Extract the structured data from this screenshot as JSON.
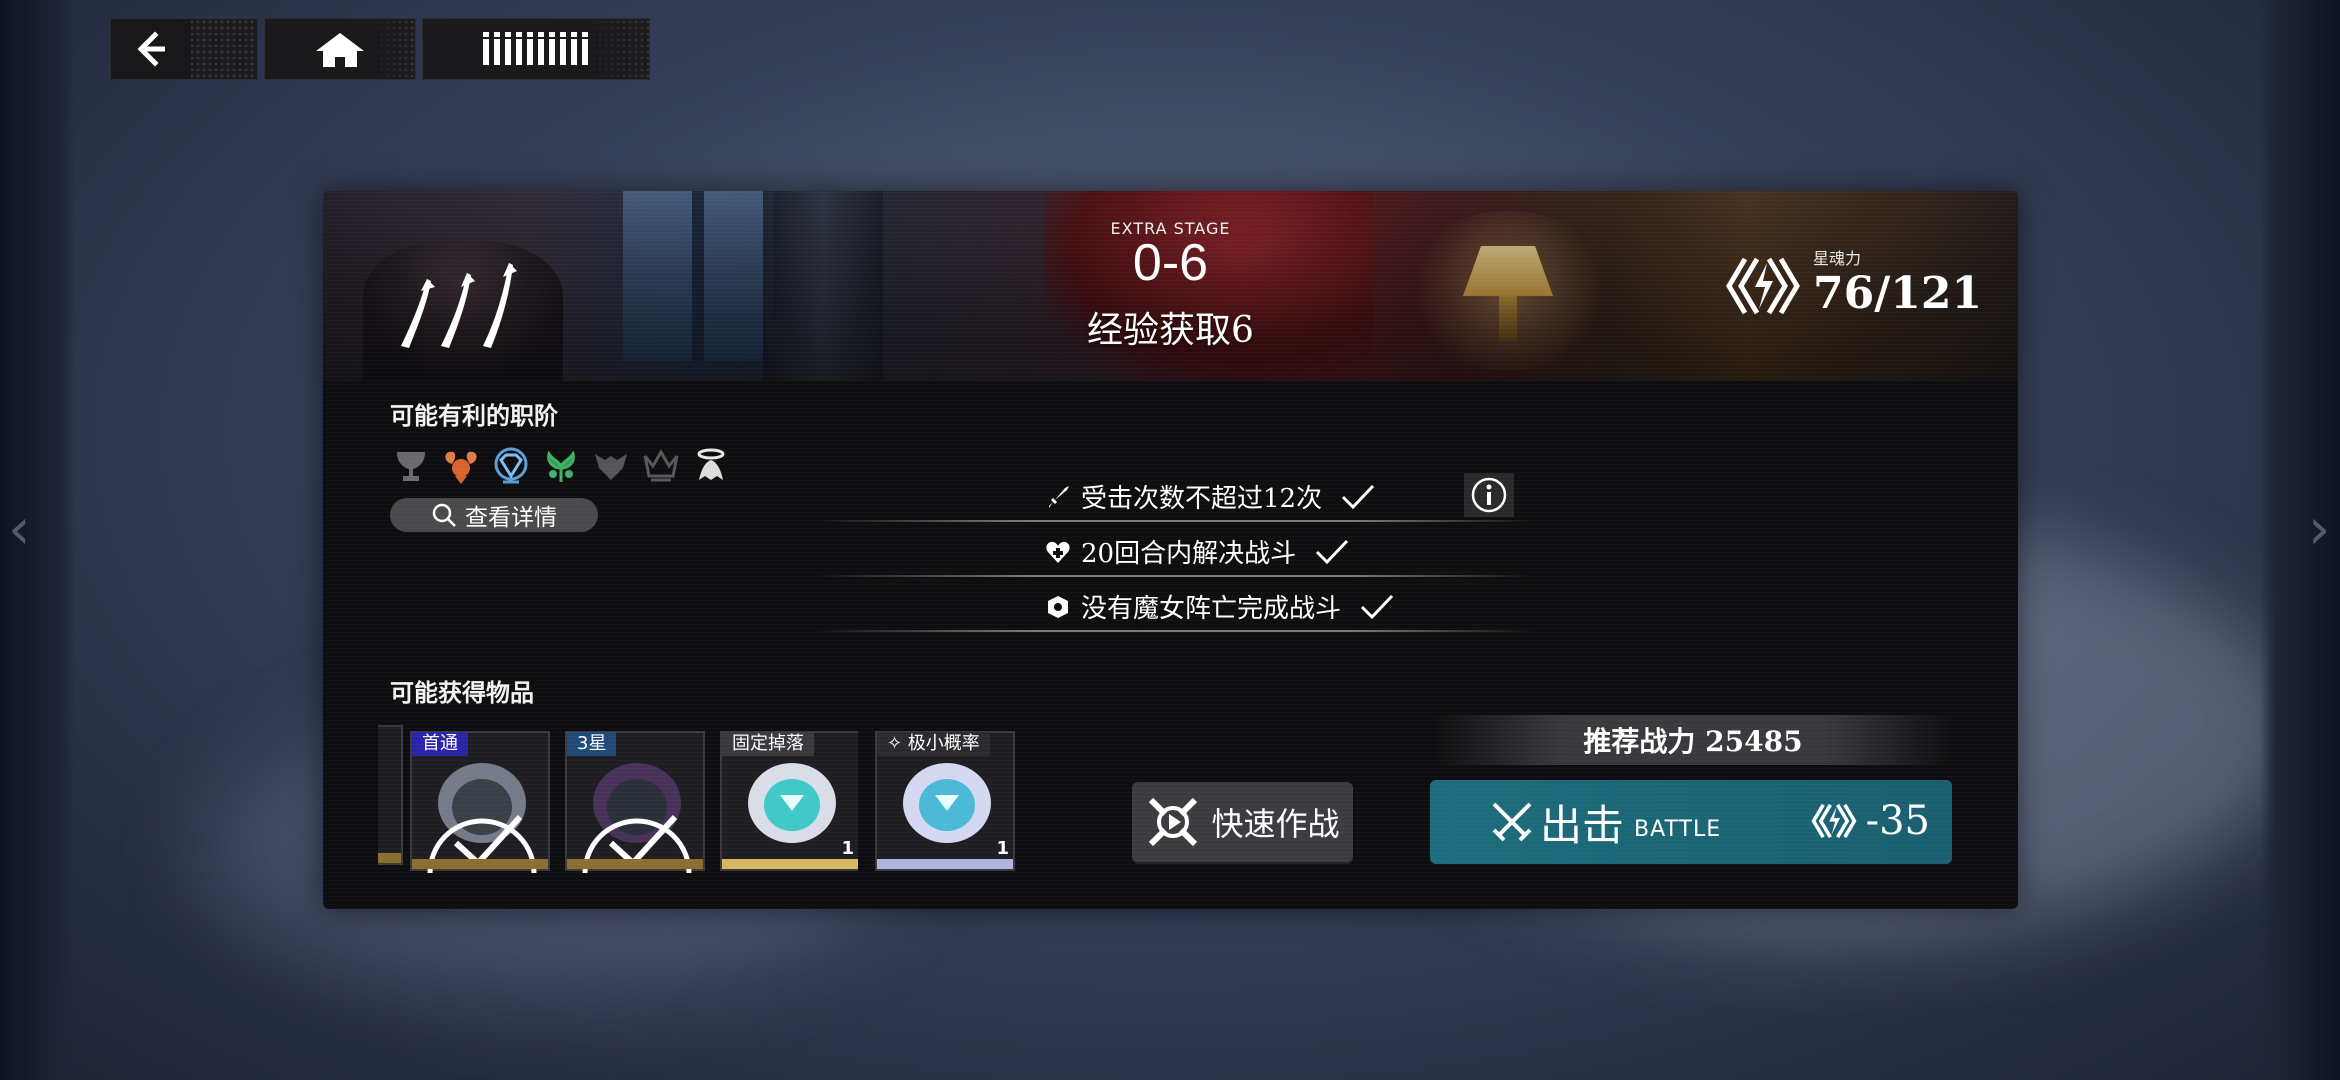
{
  "nav": {
    "back_icon": "back-arrow-icon",
    "home_icon": "home-icon",
    "menu_icon": "menu-bars-icon"
  },
  "stage": {
    "tag": "EXTRA STAGE",
    "number": "0-6",
    "name": "经验获取6",
    "stars_earned": 3
  },
  "stamina": {
    "label": "星魂力",
    "value": "76/121"
  },
  "advantage": {
    "title": "可能有利的职阶",
    "class_icons": [
      "chalice-class-icon",
      "ram-class-icon",
      "gem-class-icon",
      "tree-class-icon",
      "wolf-class-icon",
      "crown-class-icon",
      "halo-class-icon"
    ],
    "detail_button": "查看详情"
  },
  "conditions": [
    {
      "icon": "sword-icon",
      "text": "受击次数不超过12次",
      "done": true
    },
    {
      "icon": "heart-icon",
      "text": "20回合内解决战斗",
      "done": true
    },
    {
      "icon": "shield-icon",
      "text": "没有魔女阵亡完成战斗",
      "done": true
    }
  ],
  "drops": {
    "title": "可能获得物品",
    "items": [
      {
        "tag": "首通",
        "tag_color": "#2a25a8",
        "count": "",
        "claimed": true,
        "rarity_color": "#8a7030"
      },
      {
        "tag": "3星",
        "tag_color": "#1e4a7a",
        "count": "",
        "claimed": true,
        "rarity_color": "#8a7030"
      },
      {
        "tag": "固定掉落",
        "tag_color": "#3a3a3e",
        "count": "1",
        "claimed": false,
        "rarity_color": "#d8b860"
      },
      {
        "tag": "✧ 极小概率",
        "tag_color": "#2b2b2f",
        "count": "1",
        "claimed": false,
        "rarity_color": "#b0b2e0"
      }
    ]
  },
  "actions": {
    "quick_battle": "快速作战",
    "recommended_power": "推荐战力 25485",
    "battle_label": "出击",
    "battle_sub": "BATTLE",
    "battle_cost": "-35"
  }
}
